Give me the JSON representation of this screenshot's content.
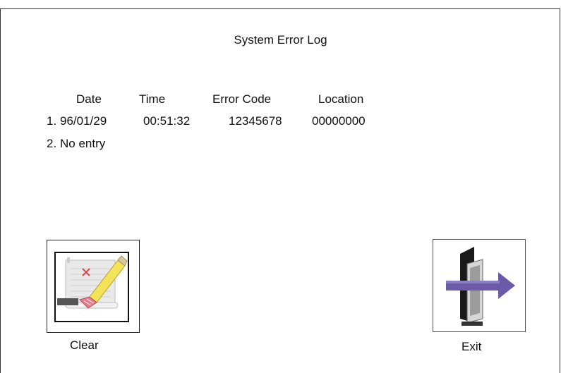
{
  "window": {
    "title": "System Error Log"
  },
  "log": {
    "headers": {
      "date": "Date",
      "time": "Time",
      "error_code": "Error Code",
      "location": "Location"
    },
    "rows": [
      {
        "index": "1.",
        "date": "96/01/29",
        "time": "00:51:32",
        "error_code": "12345678",
        "location": "00000000"
      },
      {
        "index": "2.",
        "text": "No entry"
      }
    ]
  },
  "buttons": {
    "clear": {
      "label": "Clear",
      "icon": "eraser-clear-icon"
    },
    "exit": {
      "label": "Exit",
      "icon": "exit-door-icon"
    }
  }
}
